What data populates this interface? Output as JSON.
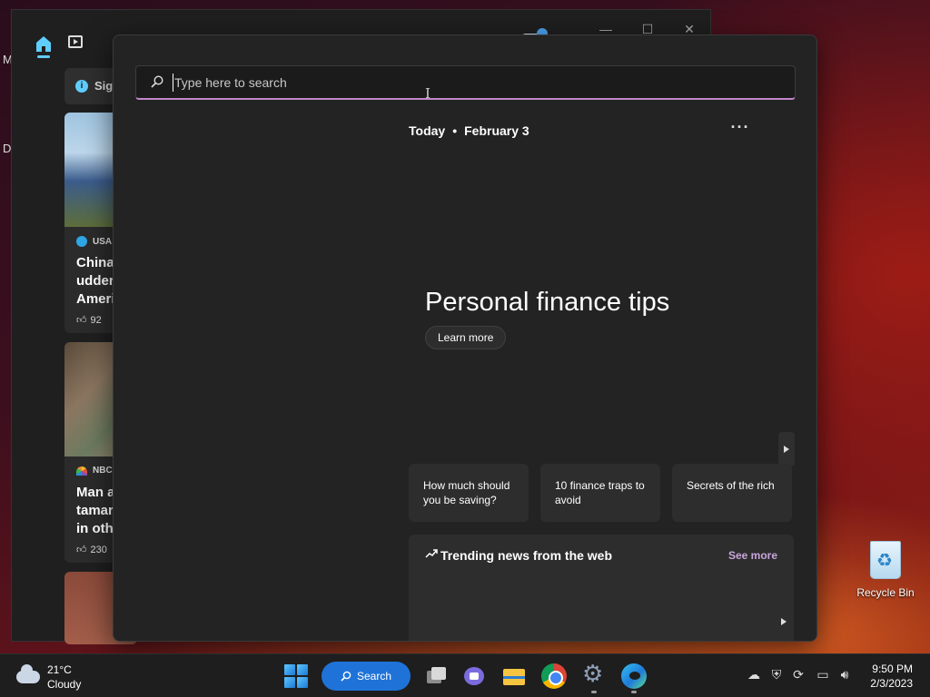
{
  "desktop": {
    "edge_letters": [
      "M",
      "D"
    ],
    "recycle_bin_label": "Recycle Bin"
  },
  "news_app": {
    "signin_label": "Sign",
    "info_glyph": "i",
    "window_controls": [
      "—",
      "☐",
      "✕"
    ],
    "cards": [
      {
        "source": "USA T",
        "title": "China\nudderi\nAmeric",
        "likes": "92"
      },
      {
        "source": "NBC",
        "title": "Man a\ntamar\nin oth",
        "likes": "230"
      },
      {
        "source": "",
        "title": "",
        "likes": ""
      }
    ]
  },
  "search": {
    "placeholder": "Type here to search",
    "value": "",
    "date_prefix": "Today",
    "date_sep": "•",
    "date": "February 3",
    "more_label": "···",
    "hero_title": "Personal finance tips",
    "learn_more_label": "Learn more",
    "tips": [
      "How much should you be saving?",
      "10 finance traps to avoid",
      "Secrets of the rich"
    ],
    "trending_title": "Trending news from the web",
    "see_more_label": "See more"
  },
  "taskbar": {
    "weather_temp": "21°C",
    "weather_desc": "Cloudy",
    "search_label": "Search",
    "time": "9:50 PM",
    "date": "2/3/2023",
    "tray_icons": [
      "onedrive-icon",
      "security-icon",
      "sync-icon",
      "display-icon",
      "volume-icon"
    ]
  },
  "colors": {
    "accent": "#1f73d8",
    "search_underline": "#c287c9",
    "see_more": "#c9a6dc",
    "info": "#60cdff"
  }
}
